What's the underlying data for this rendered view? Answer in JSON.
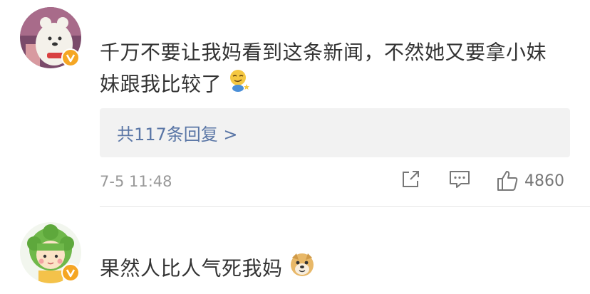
{
  "comments": [
    {
      "text_main": "千万不要让我妈看到这条新闻，不然她又要拿小妹妹跟我比较了",
      "emoji_icon": "smirk-face-emoji",
      "verified_icon": "verified-v-badge-icon",
      "reply_summary": "共117条回复 >",
      "time": "7-5 11:48",
      "likes": "4860",
      "action_icons": [
        "share-icon",
        "comment-icon",
        "thumbs-up-icon"
      ]
    },
    {
      "text_main": "果然人比人气死我妈",
      "emoji_icon": "doge-emoji",
      "verified_icon": "verified-v-badge-icon"
    }
  ],
  "colors": {
    "reply_link": "#5a76a6",
    "reply_bg": "#f2f2f2",
    "badge": "#f5a623",
    "meta": "#999999"
  }
}
